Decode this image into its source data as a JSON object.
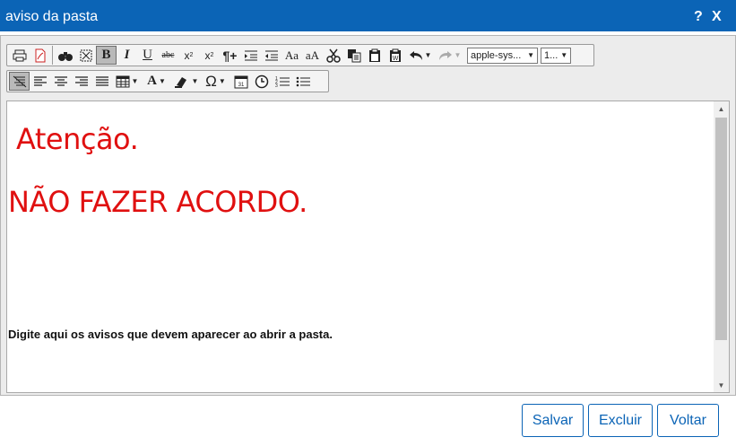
{
  "window": {
    "title": "aviso da pasta",
    "help_label": "?",
    "close_label": "X"
  },
  "toolbar": {
    "row1": [
      {
        "name": "print-icon",
        "glyph": "🖶"
      },
      {
        "name": "pdf-icon",
        "glyph": "⎘"
      },
      {
        "name": "find-icon",
        "glyph": "⚲"
      },
      {
        "name": "select-all-icon",
        "glyph": "⛶"
      },
      {
        "name": "bold-icon",
        "glyph": "B"
      },
      {
        "name": "italic-icon",
        "glyph": "I"
      },
      {
        "name": "underline-icon",
        "glyph": "U"
      },
      {
        "name": "strikethrough-icon",
        "glyph": "abc"
      },
      {
        "name": "subscript-icon",
        "glyph": "x₂"
      },
      {
        "name": "superscript-icon",
        "glyph": "x²"
      },
      {
        "name": "paragraph-icon",
        "glyph": "¶+"
      },
      {
        "name": "indent-icon",
        "glyph": "⇥"
      },
      {
        "name": "outdent-icon",
        "glyph": "⇤"
      },
      {
        "name": "uppercase-icon",
        "glyph": "Aa"
      },
      {
        "name": "lowercase-icon",
        "glyph": "aA"
      },
      {
        "name": "cut-icon",
        "glyph": "✂"
      },
      {
        "name": "copy-icon",
        "glyph": "⧉"
      },
      {
        "name": "paste-icon",
        "glyph": "📋"
      },
      {
        "name": "paste-word-icon",
        "glyph": "W"
      },
      {
        "name": "undo-icon",
        "glyph": "↶"
      },
      {
        "name": "redo-icon",
        "glyph": "↷"
      }
    ],
    "font_select": "apple-sys...",
    "size_select": "1...",
    "row2": [
      {
        "name": "no-align-icon",
        "glyph": "≡"
      },
      {
        "name": "align-left-icon",
        "glyph": "≡"
      },
      {
        "name": "align-center-icon",
        "glyph": "≡"
      },
      {
        "name": "align-right-icon",
        "glyph": "≡"
      },
      {
        "name": "justify-icon",
        "glyph": "≡"
      },
      {
        "name": "table-icon",
        "glyph": "▦"
      },
      {
        "name": "font-color-icon",
        "glyph": "A"
      },
      {
        "name": "highlight-icon",
        "glyph": "✎"
      },
      {
        "name": "special-char-icon",
        "glyph": "Ω"
      },
      {
        "name": "date-icon",
        "glyph": "▤"
      },
      {
        "name": "time-icon",
        "glyph": "◷"
      },
      {
        "name": "ordered-list-icon",
        "glyph": "☰"
      },
      {
        "name": "unordered-list-icon",
        "glyph": "☰"
      }
    ]
  },
  "content": {
    "line1": "Atenção.",
    "line2": "NÃO FAZER ACORDO.",
    "line3": "Digite aqui os avisos que devem aparecer ao abrir a pasta."
  },
  "footer": {
    "save_label": "Salvar",
    "delete_label": "Excluir",
    "back_label": "Voltar"
  },
  "colors": {
    "accent": "#0b64b6",
    "alert_text": "#e01010"
  }
}
